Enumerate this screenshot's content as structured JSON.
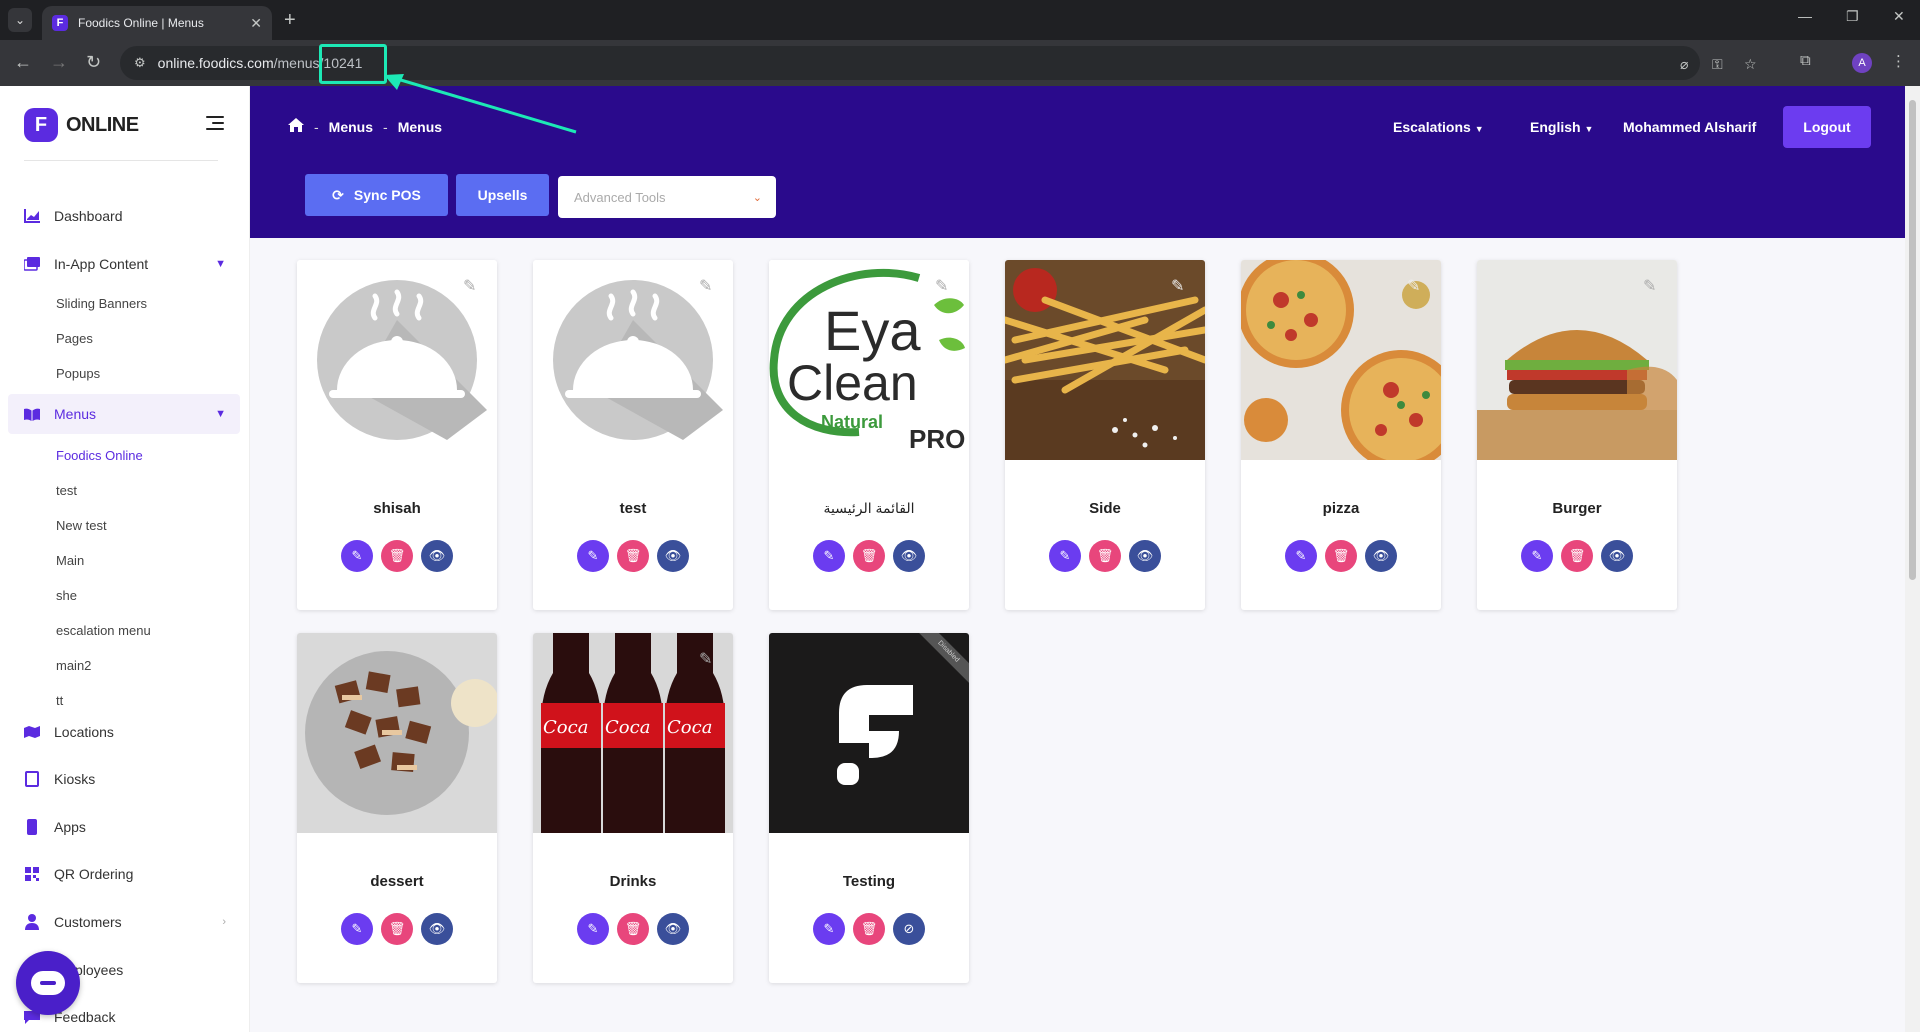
{
  "browser": {
    "tab_title": "Foodics Online | Menus",
    "favicon_letter": "F",
    "url_host": "online.foodics.com",
    "url_path": "/menus/",
    "url_id": "10241",
    "profile_initial": "A"
  },
  "sidebar": {
    "logo_letter": "F",
    "logo_text": "ONLINE",
    "items": [
      {
        "label": "Dashboard",
        "icon": "chart-icon"
      },
      {
        "label": "In-App Content",
        "icon": "images-icon"
      },
      {
        "label": "Menus",
        "icon": "book-icon"
      },
      {
        "label": "Locations",
        "icon": "map-icon"
      },
      {
        "label": "Kiosks",
        "icon": "tablet-icon"
      },
      {
        "label": "Apps",
        "icon": "mobile-icon"
      },
      {
        "label": "QR Ordering",
        "icon": "qrcode-icon"
      },
      {
        "label": "Customers",
        "icon": "user-icon"
      },
      {
        "label": "Employees",
        "icon": "users-icon"
      },
      {
        "label": "Feedback",
        "icon": "comment-icon"
      }
    ],
    "in_app_sub": [
      "Sliding Banners",
      "Pages",
      "Popups"
    ],
    "menus_sub": [
      "Foodics Online",
      "test",
      "New test",
      "Main",
      "she",
      "escalation menu",
      "main2",
      "tt"
    ]
  },
  "header": {
    "breadcrumb": [
      "Menus",
      "Menus"
    ],
    "escalations": "Escalations",
    "language": "English",
    "user_name": "Mohammed Alsharif",
    "logout": "Logout",
    "sync_pos": "Sync POS",
    "upsells": "Upsells",
    "advanced_tools_placeholder": "Advanced Tools"
  },
  "menus": [
    {
      "name": "shisah",
      "image": "placeholder-cloche"
    },
    {
      "name": "test",
      "image": "placeholder-cloche"
    },
    {
      "name": "القائمة الرئيسية",
      "image": "eya-clean-logo"
    },
    {
      "name": "Side",
      "image": "fries-photo"
    },
    {
      "name": "pizza",
      "image": "pizza-photo"
    },
    {
      "name": "Burger",
      "image": "burger-photo"
    },
    {
      "name": "dessert",
      "image": "dessert-photo"
    },
    {
      "name": "Drinks",
      "image": "cola-photo"
    },
    {
      "name": "Testing",
      "image": "foodics-logo",
      "ribbon": "Disabled"
    }
  ],
  "eya_logo": {
    "line1": "Eya",
    "line2": "Clean",
    "line3": "Natural",
    "line4": "PRO"
  }
}
